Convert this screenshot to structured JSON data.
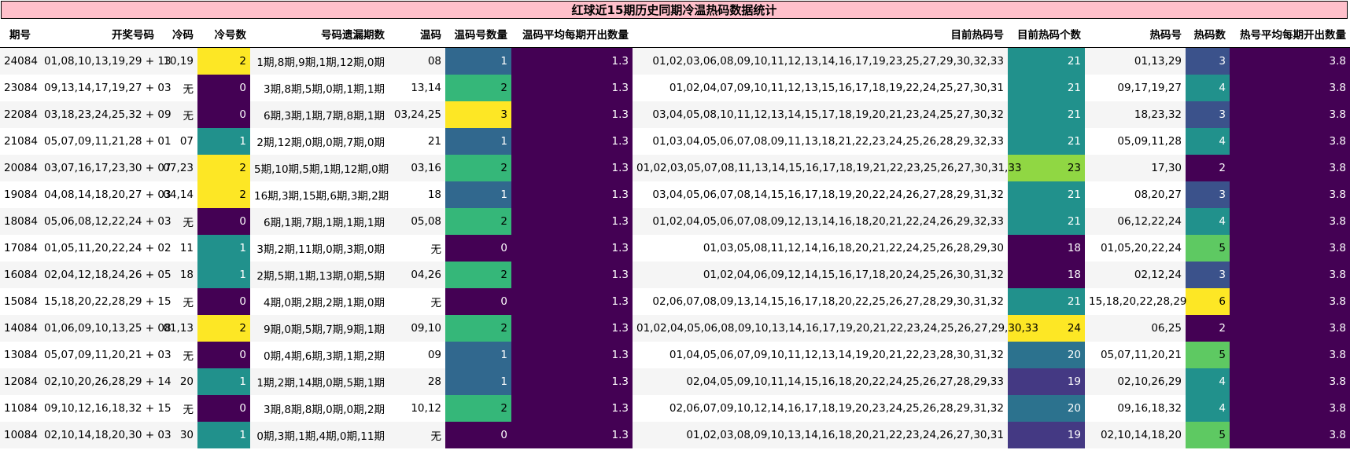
{
  "title": "红球近15期历史同期冷温热码数据统计",
  "columns": [
    "期号",
    "开奖号码",
    "冷码",
    "冷号数",
    "号码遗漏期数",
    "温码",
    "温码号数量",
    "温码平均每期开出数量",
    "目前热码号",
    "目前热码个数",
    "热码号",
    "热码数",
    "热号平均每期开出数量"
  ],
  "colors": {
    "dark_purple": "#440154",
    "indigo": "#3b528b",
    "blue": "#31688e",
    "teal": "#21918c",
    "green": "#35b779",
    "lime": "#5ec962",
    "yellow_green": "#90d743",
    "yellow": "#fde725",
    "indigo2": "#443983",
    "steel": "#2c728e",
    "title_bg": "#ffc0cb"
  },
  "rows": [
    {
      "qh": "24084",
      "kj": "01,08,10,13,19,29 + 13",
      "lm": "10,19",
      "lms": "2",
      "yl": "1期,8期,9期,1期,12期,0期",
      "wm": "08",
      "wms": "1",
      "wpj": "1.3",
      "rmh": "01,02,03,06,08,09,10,11,12,13,14,16,17,19,23,25,27,29,30,32,33",
      "rmgs": "21",
      "rh": "01,13,29",
      "rs": "3",
      "rpj": "3.8"
    },
    {
      "qh": "23084",
      "kj": "09,13,14,17,19,27 + 03",
      "lm": "无",
      "lms": "0",
      "yl": "3期,8期,5期,0期,1期,1期",
      "wm": "13,14",
      "wms": "2",
      "wpj": "1.3",
      "rmh": "01,02,04,07,09,10,11,12,13,15,16,17,18,19,22,24,25,27,30,31",
      "rmgs": "21",
      "rh": "09,17,19,27",
      "rs": "4",
      "rpj": "3.8"
    },
    {
      "qh": "22084",
      "kj": "03,18,23,24,25,32 + 09",
      "lm": "无",
      "lms": "0",
      "yl": "6期,3期,1期,7期,8期,1期",
      "wm": "03,24,25",
      "wms": "3",
      "wpj": "1.3",
      "rmh": "03,04,05,08,10,11,12,13,14,15,17,18,19,20,21,23,24,25,27,30,32",
      "rmgs": "21",
      "rh": "18,23,32",
      "rs": "3",
      "rpj": "3.8"
    },
    {
      "qh": "21084",
      "kj": "05,07,09,11,21,28 + 01",
      "lm": "07",
      "lms": "1",
      "yl": "2期,12期,0期,0期,7期,0期",
      "wm": "21",
      "wms": "1",
      "wpj": "1.3",
      "rmh": "01,03,04,05,06,07,08,09,11,13,18,21,22,23,24,25,26,28,29,32,33",
      "rmgs": "21",
      "rh": "05,09,11,28",
      "rs": "4",
      "rpj": "3.8"
    },
    {
      "qh": "20084",
      "kj": "03,07,16,17,23,30 + 07",
      "lm": "07,23",
      "lms": "2",
      "yl": "5期,10期,5期,1期,12期,0期",
      "wm": "03,16",
      "wms": "2",
      "wpj": "1.3",
      "rmh": "01,02,03,05,07,08,11,13,14,15,16,17,18,19,21,22,23,25,26,27,30,31,33",
      "rmgs": "23",
      "rh": "17,30",
      "rs": "2",
      "rpj": "3.8"
    },
    {
      "qh": "19084",
      "kj": "04,08,14,18,20,27 + 03",
      "lm": "04,14",
      "lms": "2",
      "yl": "16期,3期,15期,6期,3期,2期",
      "wm": "18",
      "wms": "1",
      "wpj": "1.3",
      "rmh": "03,04,05,06,07,08,14,15,16,17,18,19,20,22,24,26,27,28,29,31,32",
      "rmgs": "21",
      "rh": "08,20,27",
      "rs": "3",
      "rpj": "3.8"
    },
    {
      "qh": "18084",
      "kj": "05,06,08,12,22,24 + 03",
      "lm": "无",
      "lms": "0",
      "yl": "6期,1期,7期,1期,1期,1期",
      "wm": "05,08",
      "wms": "2",
      "wpj": "1.3",
      "rmh": "01,02,04,05,06,07,08,09,12,13,14,16,18,20,21,22,24,26,29,32,33",
      "rmgs": "21",
      "rh": "06,12,22,24",
      "rs": "4",
      "rpj": "3.8"
    },
    {
      "qh": "17084",
      "kj": "01,05,11,20,22,24 + 02",
      "lm": "11",
      "lms": "1",
      "yl": "3期,2期,11期,0期,3期,0期",
      "wm": "无",
      "wms": "0",
      "wpj": "1.3",
      "rmh": "01,03,05,08,11,12,14,16,18,20,21,22,24,25,26,28,29,30",
      "rmgs": "18",
      "rh": "01,05,20,22,24",
      "rs": "5",
      "rpj": "3.8"
    },
    {
      "qh": "16084",
      "kj": "02,04,12,18,24,26 + 05",
      "lm": "18",
      "lms": "1",
      "yl": "2期,5期,1期,13期,0期,5期",
      "wm": "04,26",
      "wms": "2",
      "wpj": "1.3",
      "rmh": "01,02,04,06,09,12,14,15,16,17,18,20,24,25,26,30,31,32",
      "rmgs": "18",
      "rh": "02,12,24",
      "rs": "3",
      "rpj": "3.8"
    },
    {
      "qh": "15084",
      "kj": "15,18,20,22,28,29 + 15",
      "lm": "无",
      "lms": "0",
      "yl": "4期,0期,2期,2期,1期,0期",
      "wm": "无",
      "wms": "0",
      "wpj": "1.3",
      "rmh": "02,06,07,08,09,13,14,15,16,17,18,20,22,25,26,27,28,29,30,31,32",
      "rmgs": "21",
      "rh": "15,18,20,22,28,29",
      "rs": "6",
      "rpj": "3.8"
    },
    {
      "qh": "14084",
      "kj": "01,06,09,10,13,25 + 08",
      "lm": "01,13",
      "lms": "2",
      "yl": "9期,0期,5期,7期,9期,1期",
      "wm": "09,10",
      "wms": "2",
      "wpj": "1.3",
      "rmh": "01,02,04,05,06,08,09,10,13,14,16,17,19,20,21,22,23,24,25,26,27,29,30,33",
      "rmgs": "24",
      "rh": "06,25",
      "rs": "2",
      "rpj": "3.8"
    },
    {
      "qh": "13084",
      "kj": "05,07,09,11,20,21 + 03",
      "lm": "无",
      "lms": "0",
      "yl": "0期,4期,6期,3期,1期,2期",
      "wm": "09",
      "wms": "1",
      "wpj": "1.3",
      "rmh": "01,04,05,06,07,09,10,11,12,13,14,19,20,21,22,23,28,30,31,32",
      "rmgs": "20",
      "rh": "05,07,11,20,21",
      "rs": "5",
      "rpj": "3.8"
    },
    {
      "qh": "12084",
      "kj": "02,10,20,26,28,29 + 14",
      "lm": "20",
      "lms": "1",
      "yl": "1期,2期,14期,0期,5期,1期",
      "wm": "28",
      "wms": "1",
      "wpj": "1.3",
      "rmh": "02,04,05,09,10,11,14,15,16,18,20,22,24,25,26,27,28,29,33",
      "rmgs": "19",
      "rh": "02,10,26,29",
      "rs": "4",
      "rpj": "3.8"
    },
    {
      "qh": "11084",
      "kj": "09,10,12,16,18,32 + 15",
      "lm": "无",
      "lms": "0",
      "yl": "3期,8期,8期,0期,0期,2期",
      "wm": "10,12",
      "wms": "2",
      "wpj": "1.3",
      "rmh": "02,06,07,09,10,12,14,16,17,18,19,20,23,24,25,26,28,29,31,32",
      "rmgs": "20",
      "rh": "09,16,18,32",
      "rs": "4",
      "rpj": "3.8"
    },
    {
      "qh": "10084",
      "kj": "02,10,14,18,20,30 + 03",
      "lm": "30",
      "lms": "1",
      "yl": "0期,3期,1期,4期,0期,11期",
      "wm": "无",
      "wms": "0",
      "wpj": "1.3",
      "rmh": "01,02,03,08,09,10,13,14,16,18,20,21,22,23,24,26,27,30,31",
      "rmgs": "19",
      "rh": "02,10,14,18,20",
      "rs": "5",
      "rpj": "3.8"
    }
  ]
}
